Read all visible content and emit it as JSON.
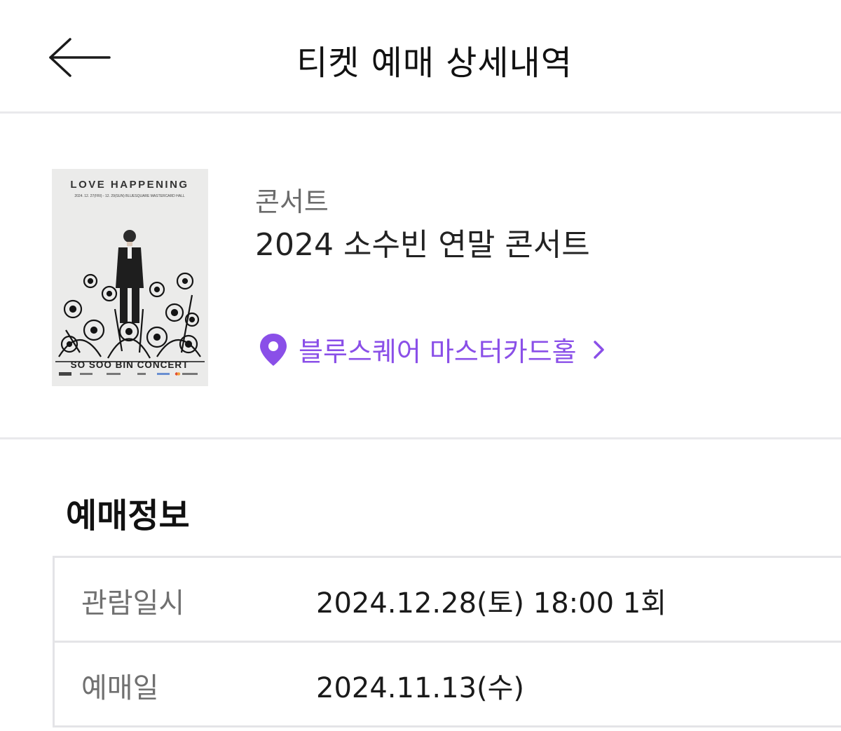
{
  "header": {
    "title": "티켓 예매 상세내역",
    "back_icon": "arrow-left-icon"
  },
  "show": {
    "category": "콘서트",
    "title": "2024 소수빈 연말 콘서트",
    "poster": {
      "top_title": "LOVE HAPPENING",
      "dates_line": "2024. 12. 27(FRI) - 12. 29(SUN)  BLUESQUARE MASTERCARD HALL",
      "bottom_title": "SO SOO BIN CONCERT"
    },
    "venue": {
      "label": "블루스퀘어 마스터카드홀",
      "icon": "map-pin-icon",
      "chevron_icon": "chevron-right-icon",
      "accent_color": "#8a4fe8"
    }
  },
  "booking": {
    "section_title": "예매정보",
    "rows": [
      {
        "label": "관람일시",
        "value": "2024.12.28(토) 18:00 1회"
      },
      {
        "label": "예매일",
        "value": "2024.11.13(수)"
      }
    ]
  }
}
